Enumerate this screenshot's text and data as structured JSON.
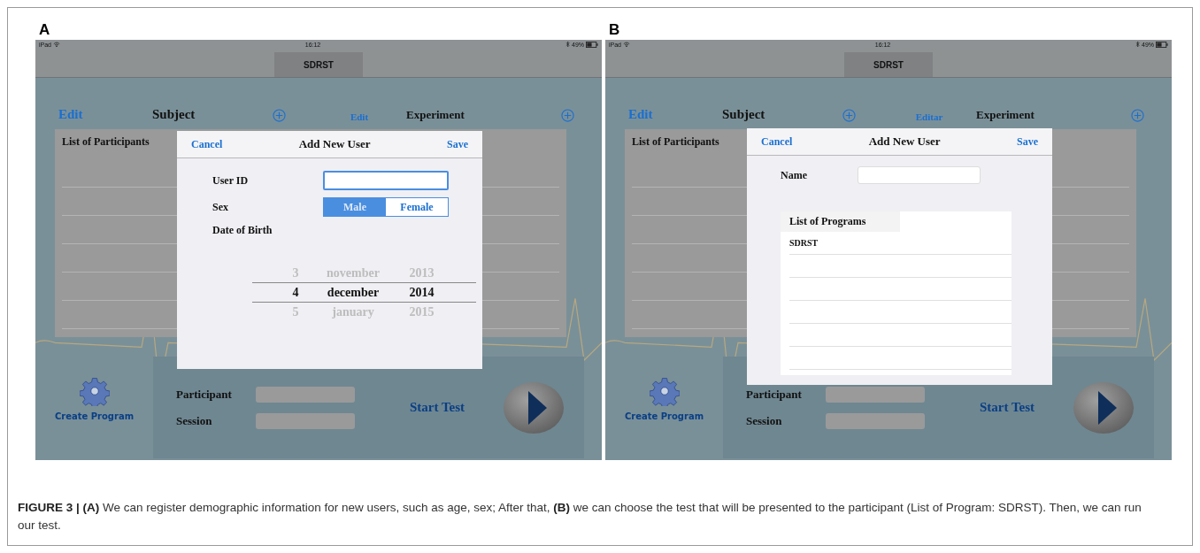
{
  "panels": [
    {
      "label": "A",
      "status_bar": {
        "device": "iPad",
        "time": "16:12",
        "battery": "49%"
      },
      "nav_title": "SDRST",
      "header": {
        "left_edit": "Edit",
        "left_title": "Subject",
        "right_edit": "Edit",
        "right_title": "Experiment"
      },
      "list": {
        "title": "List of Participants"
      },
      "bottom": {
        "create_program": "Create Program",
        "participant_label": "Participant",
        "session_label": "Session",
        "start_test": "Start Test"
      },
      "dialog": {
        "kind": "demographics",
        "cancel": "Cancel",
        "title": "Add New User",
        "save": "Save",
        "user_id_label": "User ID",
        "sex_label": "Sex",
        "sex_options": [
          {
            "label": "Male",
            "selected": true
          },
          {
            "label": "Female",
            "selected": false
          }
        ],
        "date_label": "Date of Birth",
        "date_rows": [
          {
            "day": "3",
            "month": "november",
            "year": "2013",
            "selected": false
          },
          {
            "day": "4",
            "month": "december",
            "year": "2014",
            "selected": true
          },
          {
            "day": "5",
            "month": "january",
            "year": "2015",
            "selected": false
          }
        ]
      }
    },
    {
      "label": "B",
      "status_bar": {
        "device": "iPad",
        "time": "16:12",
        "battery": "49%"
      },
      "nav_title": "SDRST",
      "header": {
        "left_edit": "Edit",
        "left_title": "Subject",
        "right_edit": "Editar",
        "right_title": "Experiment"
      },
      "list": {
        "title": "List of Participants"
      },
      "bottom": {
        "create_program": "Create Program",
        "participant_label": "Participant",
        "session_label": "Session",
        "start_test": "Start Test"
      },
      "dialog": {
        "kind": "program",
        "cancel": "Cancel",
        "title": "Add New User",
        "save": "Save",
        "name_label": "Name",
        "programs_title": "List of Programs",
        "programs": [
          "SDRST"
        ]
      }
    }
  ],
  "caption": "**FIGURE 3 | (A)** We can register demographic information for new users, such as age, sex; After that, **(B)** we can choose the test that will be presented to the participant (List of Program: SDRST). Then, we can run our test."
}
